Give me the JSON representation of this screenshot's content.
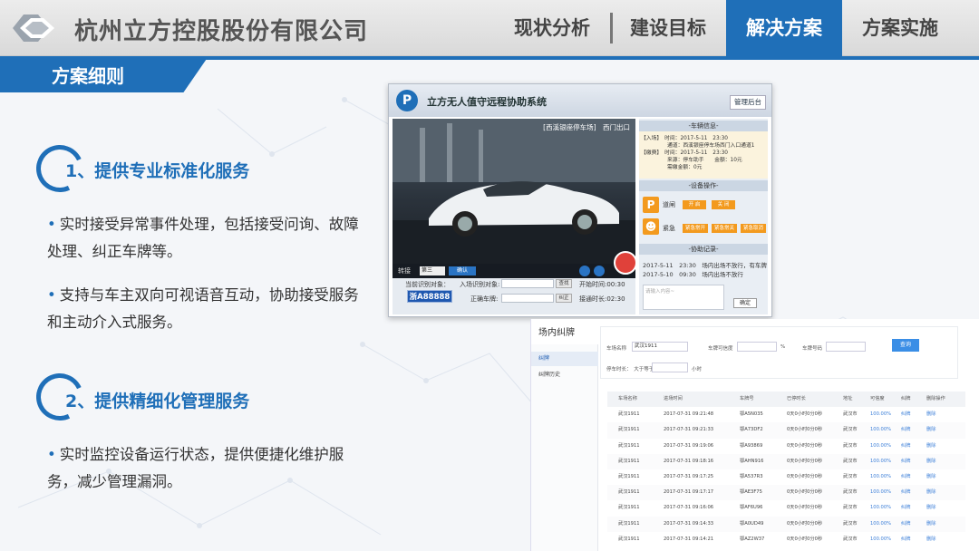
{
  "header": {
    "company": "杭州立方控股股份有限公司",
    "nav": [
      {
        "label": "现状分析",
        "active": false
      },
      {
        "label": "建设目标",
        "active": false
      },
      {
        "label": "解决方案",
        "active": true
      },
      {
        "label": "方案实施",
        "active": false
      }
    ]
  },
  "section_title": "方案细则",
  "sections": [
    {
      "title": "1、提供专业标准化服务",
      "bullets": [
        "实时接受异常事件处理，包括接受问询、故障处理、纠正车牌等。",
        "支持与车主双向可视语音互动，协助接受服务和主动介入式服务。"
      ]
    },
    {
      "title": "2、提供精细化管理服务",
      "bullets": [
        "实时监控设备运行状态，提供便捷化维护服务，减少管理漏洞。"
      ]
    }
  ],
  "app": {
    "logo": "P",
    "title": "立方无人值守远程协助系统",
    "admin_button": "管理后台",
    "video_label": "[西溪银座停车场]　西门出口",
    "transfer_label": "转接",
    "transfer_select": "第三",
    "confirm_button": "确认",
    "current_plate_label": "当前识别对象：",
    "entry_plate_label": "入场识别对象:",
    "correct_plate_label": "正确车牌:",
    "query_button": "查找",
    "correct_button": "纠正",
    "plate": "浙A88888",
    "start_time": "开始时间:00:30",
    "connect_time": "接通时长:02:30",
    "vehicle_info_header": "-车辆信息-",
    "entry_lines": [
      "【入场】　时间：2017-5-11　23:30",
      "　　　　　通道：西溪银座停车场西门入口通道1",
      "【缴费】　时间：2017-5-11　23:30",
      "　　　　　来源：停车助手　　金额：10元",
      "　　　　　需缴金额：0元"
    ],
    "device_header": "-设备操作-",
    "gate_label": "道闸",
    "open_button": "开 启",
    "close_button": "关 闭",
    "emergency_label": "紧急",
    "emergency_buttons": [
      "紧急常开",
      "紧急常关",
      "紧急取消"
    ],
    "log_header": "-协助记录-",
    "logs": [
      "2017-5-11　23:30　场内出场不放行，有车牌",
      "2017-5-10　09:30　场内出场不放行"
    ],
    "note_placeholder": "请输入内容~",
    "ok_button": "确定"
  },
  "shot2": {
    "title": "场内纠牌",
    "side_items": [
      "纠牌",
      "纠牌历史"
    ],
    "filters": {
      "lot_label": "车场名称",
      "lot_value": "武汉1911",
      "similarity_label": "车牌可信度",
      "similarity_from": "",
      "similarity_to": "",
      "percent": "%",
      "plate_label": "车牌号码",
      "plate_value": "",
      "stay_label": "停车时长：　大于等于",
      "stay_value": "",
      "hour_unit": "小时",
      "query_button": "查询"
    },
    "columns": [
      "车场名称",
      "进场时间",
      "车牌号",
      "已停时长",
      "地址",
      "可信度",
      "纠牌",
      "删除操作"
    ],
    "rows": [
      [
        "武汉1911",
        "2017-07-31 09:21:48",
        "鄂A5N035",
        "0天0小时0分0秒",
        "武汉市",
        "100.00%",
        "纠牌",
        "删除"
      ],
      [
        "武汉1911",
        "2017-07-31 09:21:33",
        "鄂A73DF2",
        "0天0小时0分0秒",
        "武汉市",
        "100.00%",
        "纠牌",
        "删除"
      ],
      [
        "武汉1911",
        "2017-07-31 09:19:06",
        "鄂A93869",
        "0天0小时0分0秒",
        "武汉市",
        "100.00%",
        "纠牌",
        "删除"
      ],
      [
        "武汉1911",
        "2017-07-31 09:18:16",
        "鄂AHN916",
        "0天0小时0分0秒",
        "武汉市",
        "100.00%",
        "纠牌",
        "删除"
      ],
      [
        "武汉1911",
        "2017-07-31 09:17:25",
        "鄂A537R3",
        "0天0小时0分0秒",
        "武汉市",
        "100.00%",
        "纠牌",
        "删除"
      ],
      [
        "武汉1911",
        "2017-07-31 09:17:17",
        "鄂AE3F75",
        "0天0小时0分0秒",
        "武汉市",
        "100.00%",
        "纠牌",
        "删除"
      ],
      [
        "武汉1911",
        "2017-07-31 09:16:06",
        "鄂AF6U96",
        "0天0小时0分0秒",
        "武汉市",
        "100.00%",
        "纠牌",
        "删除"
      ],
      [
        "武汉1911",
        "2017-07-31 09:14:33",
        "鄂A0UD49",
        "0天0小时0分0秒",
        "武汉市",
        "100.00%",
        "纠牌",
        "删除"
      ],
      [
        "武汉1911",
        "2017-07-31 09:14:21",
        "鄂AZ2W37",
        "0天0小时0分0秒",
        "武汉市",
        "100.00%",
        "纠牌",
        "删除"
      ]
    ]
  },
  "colors": {
    "brand": "#1f6fb8",
    "orange": "#f39a1e"
  }
}
